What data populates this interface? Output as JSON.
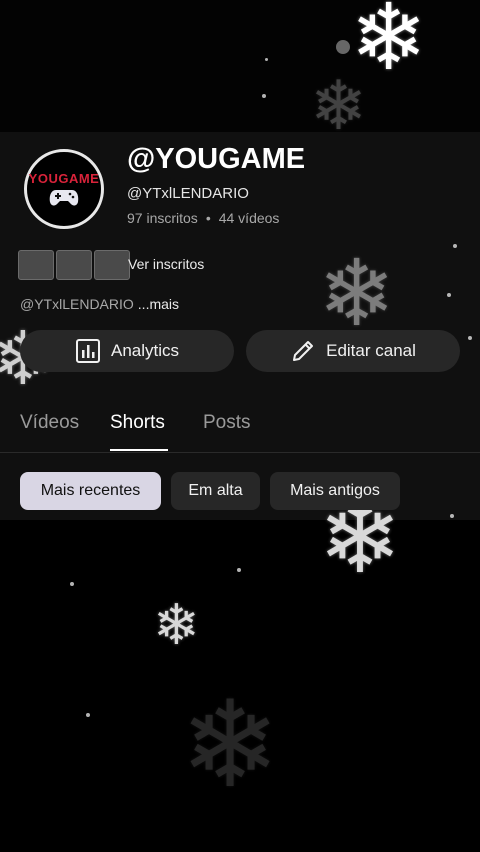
{
  "channel": {
    "name": "@YOUGAME",
    "handle": "@YTxlLENDARIO",
    "subscribers": "97 inscritos",
    "separator": "•",
    "videos": "44 vídeos",
    "avatar_logo_text": "YOUGAME"
  },
  "subscribers_row": {
    "link": "Ver inscritos"
  },
  "description": {
    "text": "@YTxlLENDARIO",
    "more": "...mais"
  },
  "actions": {
    "analytics_label": "Analytics",
    "analytics_icon": "bar-chart-icon",
    "edit_label": "Editar canal",
    "edit_icon": "pencil-icon"
  },
  "tabs": [
    {
      "label": "Vídeos",
      "active": false
    },
    {
      "label": "Shorts",
      "active": true
    },
    {
      "label": "Posts",
      "active": false
    }
  ],
  "filters": [
    {
      "label": "Mais recentes",
      "selected": true
    },
    {
      "label": "Em alta",
      "selected": false
    },
    {
      "label": "Mais antigos",
      "selected": false
    }
  ],
  "colors": {
    "panel_bg": "#101010",
    "button_bg": "#272727",
    "chip_selected_bg": "#d9d6e4",
    "logo_red": "#d9233a"
  }
}
